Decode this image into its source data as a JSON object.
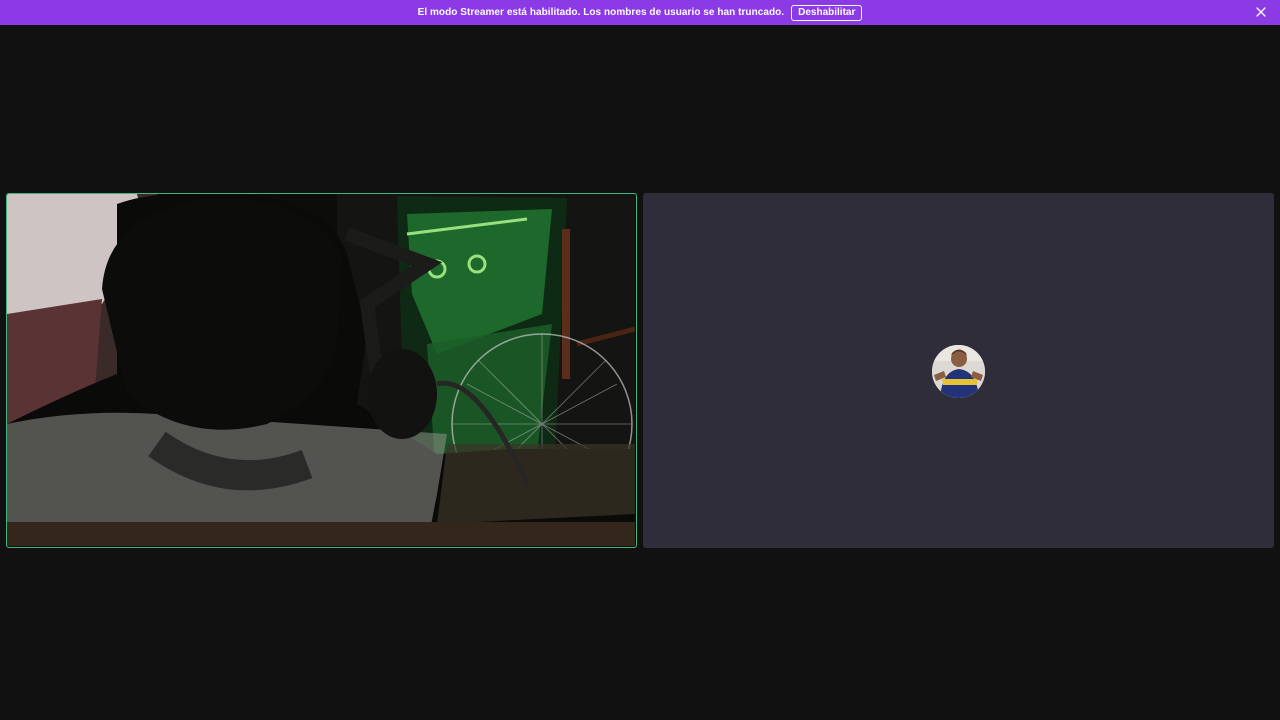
{
  "banner": {
    "message": "El modo Streamer está habilitado. Los nombres de usuario se han truncado.",
    "disable_label": "Deshabilitar",
    "close_icon": "close-icon",
    "background": "#8b3ae6"
  },
  "call": {
    "video_tile": {
      "speaking": true,
      "speaking_color": "#43b581",
      "content": "camera-feed"
    },
    "voice_tile": {
      "background": "#302d3b",
      "content": "user-avatar"
    }
  }
}
